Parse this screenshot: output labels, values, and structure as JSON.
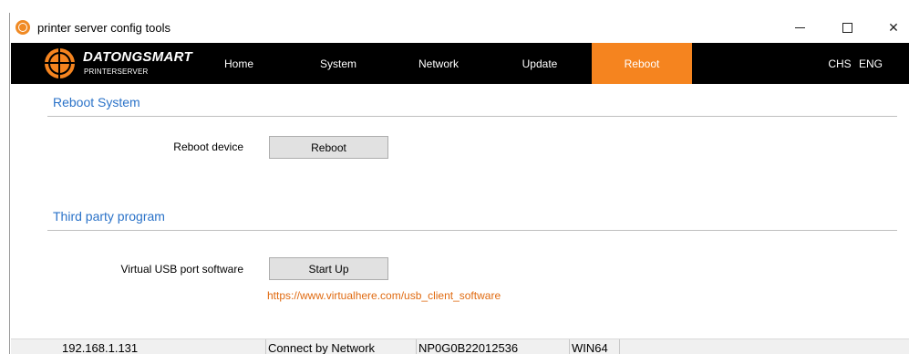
{
  "window": {
    "title": "printer server config tools"
  },
  "brand": {
    "name": "DATONGSMART",
    "subtitle": "PRINTERSERVER",
    "accent_color": "#f5841f"
  },
  "nav": {
    "items": [
      {
        "label": "Home"
      },
      {
        "label": "System"
      },
      {
        "label": "Network"
      },
      {
        "label": "Update"
      },
      {
        "label": "Reboot",
        "active": true
      }
    ],
    "languages": [
      "CHS",
      "ENG"
    ]
  },
  "reboot_section": {
    "title": "Reboot System",
    "device_label": "Reboot  device",
    "button_label": "Reboot"
  },
  "third_party_section": {
    "title": "Third party program",
    "usb_label": "Virtual USB port software",
    "button_label": "Start Up",
    "link_text": "https://www.virtualhere.com/usb_client_software"
  },
  "status_bar": {
    "ip": "192.168.1.131",
    "connection": "Connect by Network",
    "serial": "NP0G0B22012536",
    "os": "WIN64"
  }
}
